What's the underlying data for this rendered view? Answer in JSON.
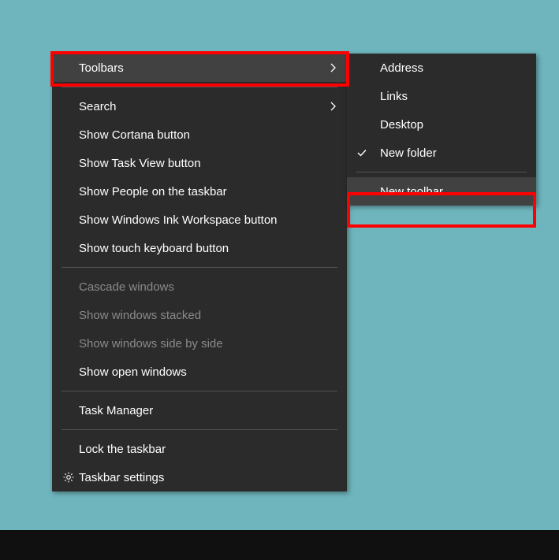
{
  "main_menu": {
    "toolbars": "Toolbars",
    "search": "Search",
    "show_cortana": "Show Cortana button",
    "show_task_view": "Show Task View button",
    "show_people": "Show People on the taskbar",
    "show_ink": "Show Windows Ink Workspace button",
    "show_touch_keyboard": "Show touch keyboard button",
    "cascade": "Cascade windows",
    "stacked": "Show windows stacked",
    "side_by_side": "Show windows side by side",
    "show_open": "Show open windows",
    "task_manager": "Task Manager",
    "lock_taskbar": "Lock the taskbar",
    "taskbar_settings": "Taskbar settings"
  },
  "submenu": {
    "address": "Address",
    "links": "Links",
    "desktop": "Desktop",
    "new_folder": "New folder",
    "new_toolbar": "New toolbar..."
  }
}
